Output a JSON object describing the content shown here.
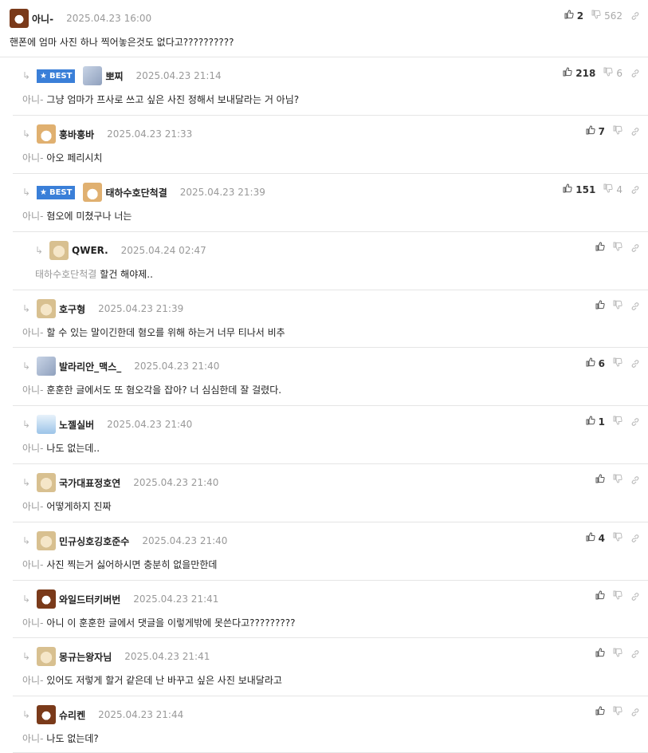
{
  "comments": [
    {
      "nick": "아니-",
      "date": "2025.04.23 16:00",
      "text": "핸폰에 엄마 사진 하나 찍어놓은것도 없다고??????????",
      "up": "2",
      "down": "562",
      "avatar": "dog-avatar",
      "best": false,
      "level": 0,
      "mention": ""
    },
    {
      "nick": "뽀찌",
      "date": "2025.04.23 21:14",
      "text": "그냥 엄마가 프사로 쓰고 싶은 사진 정해서 보내달라는 거 아님?",
      "up": "218",
      "down": "6",
      "avatar": "gray-cat-avatar",
      "best": true,
      "level": 1,
      "mention": "아니-"
    },
    {
      "nick": "훙바훙바",
      "date": "2025.04.23 21:33",
      "text": "아오 페리시치",
      "up": "7",
      "down": "",
      "avatar": "fox-avatar",
      "best": false,
      "level": 1,
      "mention": "아니-"
    },
    {
      "nick": "태하수호단척결",
      "date": "2025.04.23 21:39",
      "text": "혐오에 미쳤구나 너는",
      "up": "151",
      "down": "4",
      "avatar": "fox-avatar",
      "best": true,
      "level": 1,
      "mention": "아니-"
    },
    {
      "nick": "QWER.",
      "date": "2025.04.24 02:47",
      "text": "할건 해야제..",
      "up": "",
      "down": "",
      "avatar": "puppy-avatar",
      "best": false,
      "level": 2,
      "mention": "태하수호단척결"
    },
    {
      "nick": "호구형",
      "date": "2025.04.23 21:39",
      "text": "할 수 있는 말이긴한데 혐오를 위해 하는거 너무 티나서 비추",
      "up": "",
      "down": "",
      "avatar": "puppy-avatar",
      "best": false,
      "level": 1,
      "mention": "아니-"
    },
    {
      "nick": "발라리안_맥스_",
      "date": "2025.04.23 21:40",
      "text": "훈훈한 글에서도 또 혐오각을 잡아? 너 심심한데 잘 걸렸다.",
      "up": "6",
      "down": "",
      "avatar": "gray-cat-avatar",
      "best": false,
      "level": 1,
      "mention": "아니-"
    },
    {
      "nick": "노젤실버",
      "date": "2025.04.23 21:40",
      "text": "나도 없는데..",
      "up": "1",
      "down": "",
      "avatar": "blue-avatar",
      "best": false,
      "level": 1,
      "mention": "아니-"
    },
    {
      "nick": "국가대표정호연",
      "date": "2025.04.23 21:40",
      "text": "어떻게하지 진짜",
      "up": "",
      "down": "",
      "avatar": "puppy-avatar",
      "best": false,
      "level": 1,
      "mention": "아니-"
    },
    {
      "nick": "민규싱호깅호준수",
      "date": "2025.04.23 21:40",
      "text": "사진 찍는거 싫어하시면 충분히 없을만한데",
      "up": "4",
      "down": "",
      "avatar": "puppy-avatar",
      "best": false,
      "level": 1,
      "mention": "아니-"
    },
    {
      "nick": "와일드터키버번",
      "date": "2025.04.23 21:41",
      "text": "아니 이 훈훈한 글에서 댓글을 이렇게밖에 못쓴다고?????????",
      "up": "",
      "down": "",
      "avatar": "dog-avatar",
      "best": false,
      "level": 1,
      "mention": "아니-"
    },
    {
      "nick": "몽규는왕자님",
      "date": "2025.04.23 21:41",
      "text": "있어도 저렇게 할거 같은데 난 바꾸고 싶은 사진 보내달라고",
      "up": "",
      "down": "",
      "avatar": "puppy-avatar",
      "best": false,
      "level": 1,
      "mention": "아니-"
    },
    {
      "nick": "슈리켄",
      "date": "2025.04.23 21:44",
      "text": "나도 없는데?",
      "up": "",
      "down": "",
      "avatar": "dog-avatar",
      "best": false,
      "level": 1,
      "mention": "아니-"
    }
  ],
  "labels": {
    "best": "BEST"
  },
  "icons": {
    "thumbs_up": "thumbs-up-icon",
    "thumbs_down": "thumbs-down-icon",
    "link": "link-icon",
    "reply_arrow": "reply-arrow-icon",
    "star": "star-icon"
  },
  "colors": {
    "best_bg": "#3a7fd8",
    "muted": "#999999",
    "border": "#e5e5e5"
  }
}
